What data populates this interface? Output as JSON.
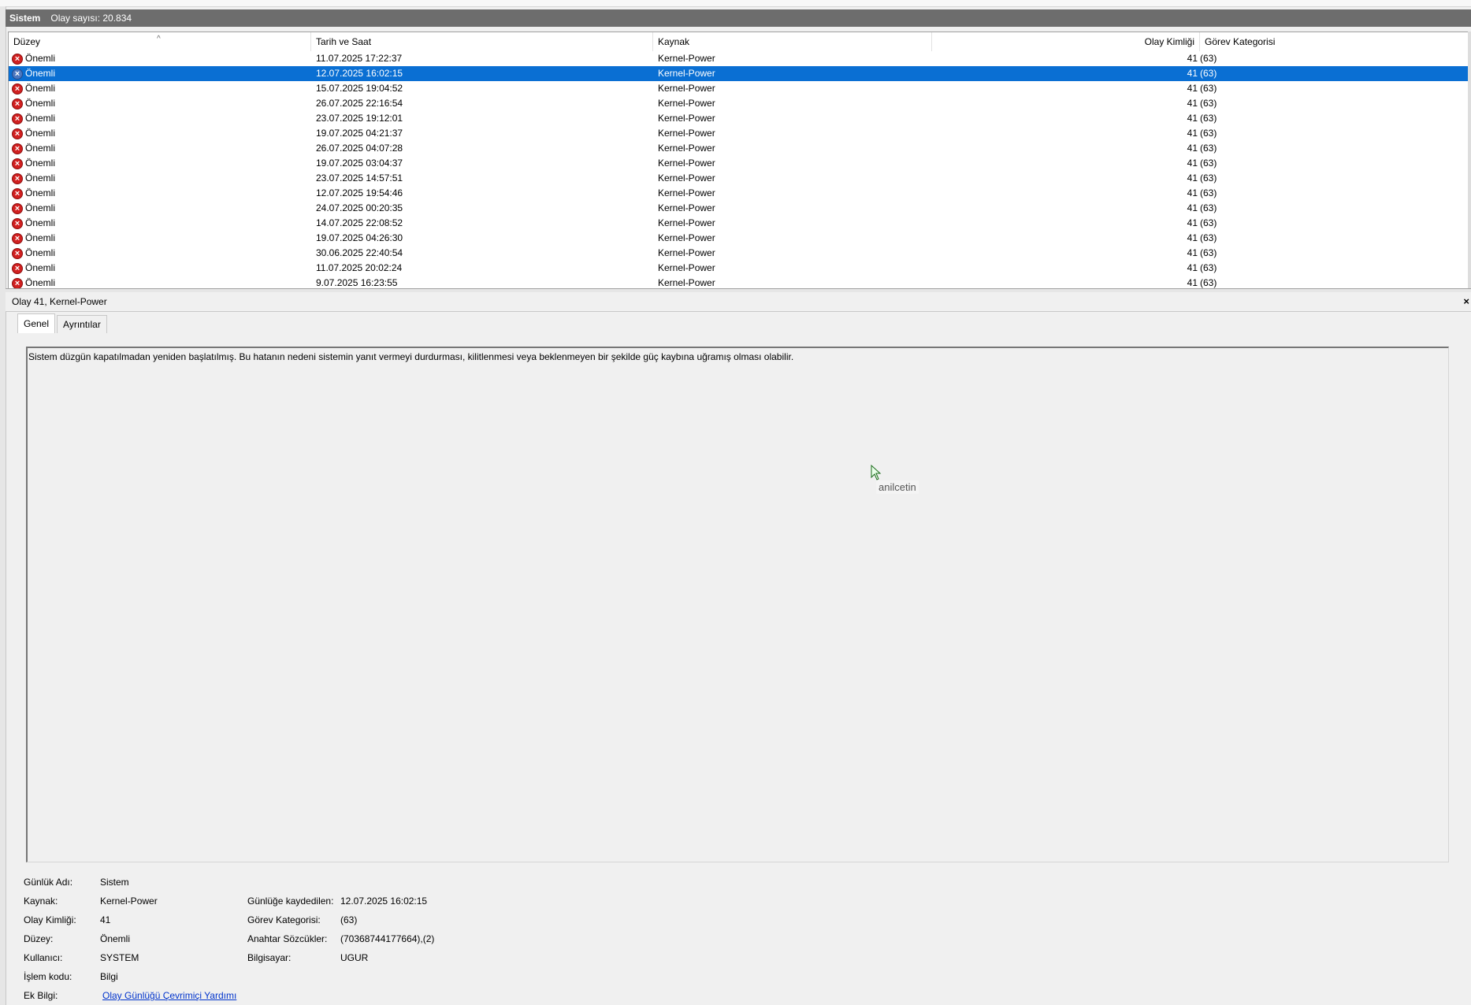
{
  "panel": {
    "title": "Sistem",
    "count_text": "Olay sayısı: 20.834"
  },
  "columns": {
    "level": "Düzey",
    "datetime": "Tarih ve Saat",
    "source": "Kaynak",
    "event_id": "Olay Kimliği",
    "category": "Görev Kategorisi"
  },
  "events": [
    {
      "level": "Önemli",
      "datetime": "11.07.2025 17:22:37",
      "source": "Kernel-Power",
      "event_id": "41",
      "category": "(63)"
    },
    {
      "level": "Önemli",
      "datetime": "12.07.2025 16:02:15",
      "source": "Kernel-Power",
      "event_id": "41",
      "category": "(63)",
      "selected": true
    },
    {
      "level": "Önemli",
      "datetime": "15.07.2025 19:04:52",
      "source": "Kernel-Power",
      "event_id": "41",
      "category": "(63)"
    },
    {
      "level": "Önemli",
      "datetime": "26.07.2025 22:16:54",
      "source": "Kernel-Power",
      "event_id": "41",
      "category": "(63)"
    },
    {
      "level": "Önemli",
      "datetime": "23.07.2025 19:12:01",
      "source": "Kernel-Power",
      "event_id": "41",
      "category": "(63)"
    },
    {
      "level": "Önemli",
      "datetime": "19.07.2025 04:21:37",
      "source": "Kernel-Power",
      "event_id": "41",
      "category": "(63)"
    },
    {
      "level": "Önemli",
      "datetime": "26.07.2025 04:07:28",
      "source": "Kernel-Power",
      "event_id": "41",
      "category": "(63)"
    },
    {
      "level": "Önemli",
      "datetime": "19.07.2025 03:04:37",
      "source": "Kernel-Power",
      "event_id": "41",
      "category": "(63)"
    },
    {
      "level": "Önemli",
      "datetime": "23.07.2025 14:57:51",
      "source": "Kernel-Power",
      "event_id": "41",
      "category": "(63)"
    },
    {
      "level": "Önemli",
      "datetime": "12.07.2025 19:54:46",
      "source": "Kernel-Power",
      "event_id": "41",
      "category": "(63)"
    },
    {
      "level": "Önemli",
      "datetime": "24.07.2025 00:20:35",
      "source": "Kernel-Power",
      "event_id": "41",
      "category": "(63)"
    },
    {
      "level": "Önemli",
      "datetime": "14.07.2025 22:08:52",
      "source": "Kernel-Power",
      "event_id": "41",
      "category": "(63)"
    },
    {
      "level": "Önemli",
      "datetime": "19.07.2025 04:26:30",
      "source": "Kernel-Power",
      "event_id": "41",
      "category": "(63)"
    },
    {
      "level": "Önemli",
      "datetime": "30.06.2025 22:40:54",
      "source": "Kernel-Power",
      "event_id": "41",
      "category": "(63)"
    },
    {
      "level": "Önemli",
      "datetime": "11.07.2025 20:02:24",
      "source": "Kernel-Power",
      "event_id": "41",
      "category": "(63)"
    },
    {
      "level": "Önemli",
      "datetime": "9.07.2025 16:23:55",
      "source": "Kernel-Power",
      "event_id": "41",
      "category": "(63)"
    }
  ],
  "detail": {
    "title": "Olay 41, Kernel-Power",
    "close_glyph": "×",
    "tabs": [
      "Genel",
      "Ayrıntılar"
    ],
    "message": "Sistem düzgün kapatılmadan yeniden başlatılmış. Bu hatanın nedeni sistemin yanıt vermeyi durdurması, kilitlenmesi veya beklenmeyen bir şekilde güç kaybına uğramış olması olabilir.",
    "watermark": "anilcetin"
  },
  "properties": {
    "log_name": {
      "label": "Günlük Adı:",
      "value": "Sistem"
    },
    "source": {
      "label": "Kaynak:",
      "value": "Kernel-Power"
    },
    "logged": {
      "label": "Günlüğe kaydedilen:",
      "value": "12.07.2025 16:02:15"
    },
    "event_id": {
      "label": "Olay Kimliği:",
      "value": "41"
    },
    "task_category": {
      "label": "Görev Kategorisi:",
      "value": "(63)"
    },
    "level": {
      "label": "Düzey:",
      "value": "Önemli"
    },
    "keywords": {
      "label": "Anahtar Sözcükler:",
      "value": "(70368744177664),(2)"
    },
    "user": {
      "label": "Kullanıcı:",
      "value": "SYSTEM"
    },
    "computer": {
      "label": "Bilgisayar:",
      "value": "UGUR"
    },
    "opcode": {
      "label": "İşlem kodu:",
      "value": "Bilgi"
    },
    "more_info": {
      "label": "Ek Bilgi:",
      "link": "Olay Günlüğü Çevrimiçi Yardımı"
    }
  },
  "icons": {
    "error": "error-circle-icon",
    "sort": "sort-ascending-icon",
    "cursor": "mouse-pointer-icon"
  },
  "colors": {
    "selection": "#0a6fd3",
    "title_bar": "#6d6d6d",
    "error": "#d12020",
    "link": "#0033cc"
  }
}
